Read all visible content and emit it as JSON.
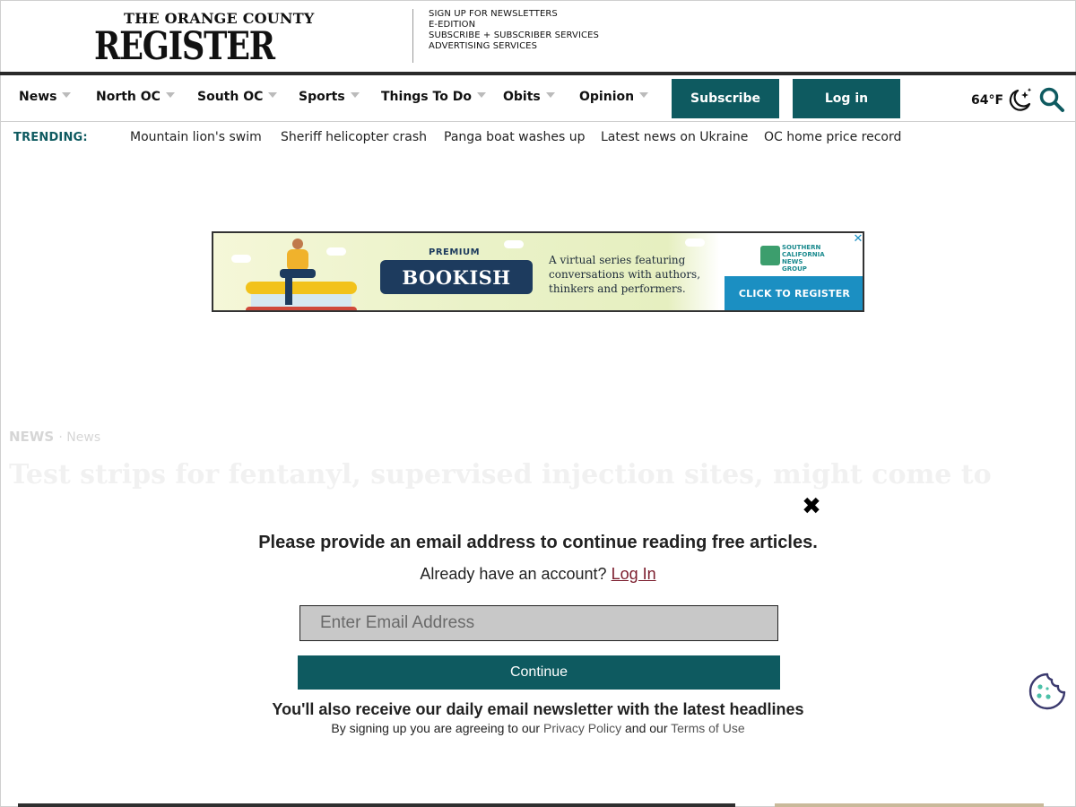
{
  "masthead": {
    "logo_small": "THE ORANGE COUNTY",
    "logo_big": "REGISTER",
    "links": [
      "SIGN UP FOR NEWSLETTERS",
      "E-EDITION",
      "SUBSCRIBE + SUBSCRIBER SERVICES",
      "ADVERTISING SERVICES"
    ]
  },
  "nav": {
    "items": [
      "News",
      "North OC",
      "South OC",
      "Sports",
      "Things To Do",
      "Obits",
      "Opinion"
    ],
    "subscribe_label": "Subscribe",
    "login_label": "Log in",
    "weather": "64°F",
    "weather_icon": "moon-stars-icon",
    "search_icon": "search-icon"
  },
  "trending": {
    "label": "TRENDING:",
    "links": [
      "Mountain lion's swim",
      "Sheriff helicopter crash",
      "Panga boat washes up",
      "Latest news on Ukraine",
      "OC home price record"
    ]
  },
  "ad": {
    "premium": "PREMIUM",
    "title": "BOOKISH",
    "description": "A virtual series featuring conversations with authors, thinkers and performers.",
    "sponsor": "SOUTHERN CALIFORNIA NEWS GROUP",
    "cta": "CLICK TO REGISTER",
    "close": "✕"
  },
  "article": {
    "kicker": "NEWS",
    "kicker_sub": "News",
    "title": "Test strips for fentanyl, supervised injection sites, might come to"
  },
  "modal": {
    "close": "✖",
    "heading": "Please provide an email address to continue reading free articles.",
    "account_text": "Already have an account?",
    "login_link": "Log In",
    "email_placeholder": "Enter Email Address",
    "continue_label": "Continue",
    "newsletter_note": "You'll also receive our daily email newsletter with the latest headlines",
    "legal_prefix": "By signing up you are agreeing to our",
    "privacy_link": "Privacy Policy",
    "legal_mid": "and our",
    "terms_link": "Terms of Use"
  },
  "colors": {
    "accent": "#0e5a60",
    "login_link": "#7b1c2c",
    "ad_cta": "#1b8fc2"
  }
}
